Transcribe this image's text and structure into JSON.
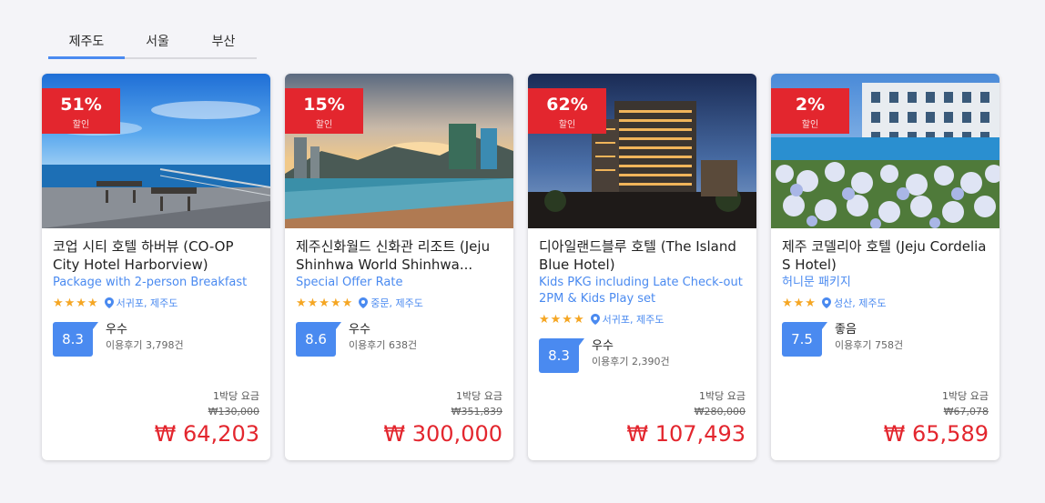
{
  "tabs": [
    {
      "label": "제주도",
      "active": true
    },
    {
      "label": "서울",
      "active": false
    },
    {
      "label": "부산",
      "active": false
    }
  ],
  "cards": [
    {
      "discount": "51%",
      "discount_label": "할인",
      "name": "코업 시티 호텔 하버뷰 (CO-OP City Hotel Harborview)",
      "offer": "Package with 2-person Breakfast",
      "stars": "★★★★",
      "location": "서귀포, 제주도",
      "score": "8.3",
      "rating_word": "우수",
      "review_count": "이용후기 3,798건",
      "price_label": "1박당 요금",
      "original_price": "₩130,000",
      "price": "₩ 64,203"
    },
    {
      "discount": "15%",
      "discount_label": "할인",
      "name": "제주신화월드 신화관 리조트 (Jeju Shinhwa World Shinhwa...",
      "offer": "Special Offer Rate",
      "stars": "★★★★★",
      "location": "중문, 제주도",
      "score": "8.6",
      "rating_word": "우수",
      "review_count": "이용후기 638건",
      "price_label": "1박당 요금",
      "original_price": "₩351,839",
      "price": "₩ 300,000"
    },
    {
      "discount": "62%",
      "discount_label": "할인",
      "name": "디아일랜드블루 호텔 (The Island Blue Hotel)",
      "offer": "Kids PKG including Late Check-out 2PM & Kids Play set",
      "stars": "★★★★",
      "location": "서귀포, 제주도",
      "score": "8.3",
      "rating_word": "우수",
      "review_count": "이용후기 2,390건",
      "price_label": "1박당 요금",
      "original_price": "₩280,000",
      "price": "₩ 107,493"
    },
    {
      "discount": "2%",
      "discount_label": "할인",
      "name": "제주 코델리아 호텔 (Jeju Cordelia S Hotel)",
      "offer": "허니문 패키지",
      "stars": "★★★",
      "location": "성산, 제주도",
      "score": "7.5",
      "rating_word": "좋음",
      "review_count": "이용후기 758건",
      "price_label": "1박당 요금",
      "original_price": "₩67,078",
      "price": "₩ 65,589"
    }
  ],
  "colors": {
    "accent": "#4a8af0",
    "discount": "#e3262e",
    "star": "#f5a623"
  },
  "icons": {
    "location": "map-pin-icon",
    "star": "star-icon"
  }
}
